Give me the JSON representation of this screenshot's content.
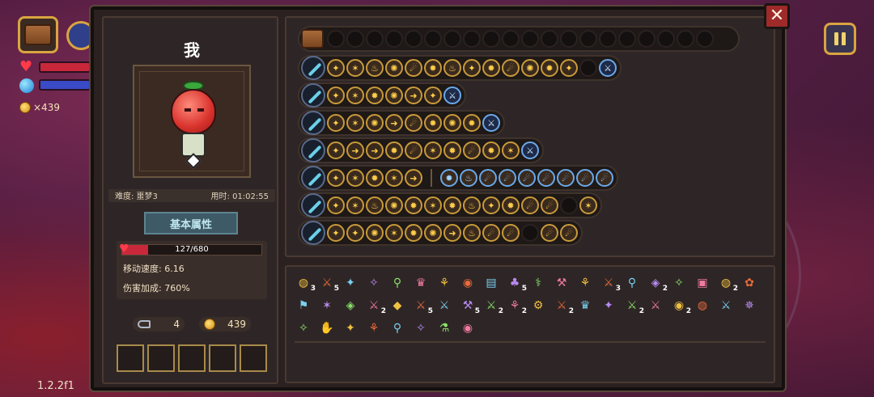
{
  "hud": {
    "gold": "×439",
    "version": "1.2.2f1",
    "close": "✕"
  },
  "character": {
    "name": "我",
    "difficulty": "难度: 噩梦3",
    "time": "用时: 01:02:55",
    "tab": "基本属性",
    "hp": {
      "text": "127/680",
      "fraction": 0.187
    },
    "speed": "移动速度: 6.16",
    "damage": "伤害加成: 760%",
    "keys": "4",
    "coins": "439"
  },
  "icons": {
    "chest": "chest-icon",
    "pause": "pause-icon",
    "close": "close-icon",
    "heart": "heart-icon",
    "mana": "mana-orb-icon",
    "coin": "coin-icon",
    "key": "key-icon"
  },
  "colors": {
    "hp": "#c8283a",
    "mp": "#3a4bc8",
    "gold_border": "#d9a441",
    "close": "#9e2a2a",
    "tab": "#3e5a66"
  },
  "chest_row_empty_slots": 20,
  "weapons": [
    {
      "weapon": "emerald-staff",
      "chips": [
        "✦",
        "✶",
        "♨",
        "✺",
        "☄",
        "✹",
        "♨",
        "✦",
        "✹",
        "☄",
        "✺",
        "✹",
        "✦",
        ""
      ],
      "blue": 1
    },
    {
      "weapon": "azure-spear",
      "chips": [
        "✦",
        "✶",
        "✹",
        "✺",
        "➜",
        "✦"
      ],
      "blue": 1
    },
    {
      "weapon": "violet-flower-staff",
      "chips": [
        "✦",
        "✶",
        "✺",
        "➜",
        "☄",
        "✹",
        "✺",
        "✹"
      ],
      "blue": 1
    },
    {
      "weapon": "shadow-scythe",
      "chips": [
        "✦",
        "➜",
        "➜",
        "✹",
        "☄",
        "✶",
        "✹",
        "☄",
        "✹",
        "✶"
      ],
      "blue": 1
    },
    {
      "weapon": "void-halberd",
      "chips": [
        "✦",
        "✶",
        "✹",
        "✶",
        "➜"
      ],
      "blue": 0,
      "chips2": [
        "✹",
        "♨",
        "☄",
        "☄",
        "☄",
        "☄",
        "☄",
        "☄",
        "☄"
      ]
    },
    {
      "weapon": "arcane-staff",
      "chips": [
        "✦",
        "✶",
        "♨",
        "✺",
        "✹",
        "✶",
        "✹",
        "♨",
        "✦",
        "✹",
        "☄",
        "☄",
        "",
        "✶"
      ],
      "blue": 0
    },
    {
      "weapon": "eclipse-orb-staff",
      "chips": [
        "✦",
        "✦",
        "✺",
        "✶",
        "✹",
        "✺",
        "➜",
        "♨",
        "☄",
        "☄",
        "",
        "☄",
        "☄"
      ],
      "blue": 0
    }
  ],
  "items": [
    {
      "g": "◍",
      "c": "3"
    },
    {
      "g": "⚔",
      "c": "5"
    },
    {
      "g": "✦",
      "c": ""
    },
    {
      "g": "✧",
      "c": ""
    },
    {
      "g": "⚲",
      "c": ""
    },
    {
      "g": "♛",
      "c": ""
    },
    {
      "g": "⚘",
      "c": ""
    },
    {
      "g": "◉",
      "c": ""
    },
    {
      "g": "▤",
      "c": ""
    },
    {
      "g": "♣",
      "c": "5"
    },
    {
      "g": "⚕",
      "c": ""
    },
    {
      "g": "⚒",
      "c": ""
    },
    {
      "g": "⚘",
      "c": ""
    },
    {
      "g": "⚔",
      "c": "3"
    },
    {
      "g": "⚲",
      "c": ""
    },
    {
      "g": "◈",
      "c": "2"
    },
    {
      "g": "✧",
      "c": ""
    },
    {
      "g": "▣",
      "c": ""
    },
    {
      "g": "◍",
      "c": "2"
    },
    {
      "g": "✿",
      "c": ""
    },
    {
      "g": "⚑",
      "c": ""
    },
    {
      "g": "✶",
      "c": ""
    },
    {
      "g": "◈",
      "c": ""
    },
    {
      "g": "⚔",
      "c": "2"
    },
    {
      "g": "◆",
      "c": ""
    },
    {
      "g": "⚔",
      "c": "5"
    },
    {
      "g": "⚔",
      "c": ""
    },
    {
      "g": "⚒",
      "c": "5"
    },
    {
      "g": "⚔",
      "c": "2"
    },
    {
      "g": "⚘",
      "c": "2"
    },
    {
      "g": "⚙",
      "c": ""
    },
    {
      "g": "⚔",
      "c": "2"
    },
    {
      "g": "♛",
      "c": ""
    },
    {
      "g": "✦",
      "c": ""
    },
    {
      "g": "⚔",
      "c": "2"
    },
    {
      "g": "⚔",
      "c": ""
    },
    {
      "g": "◉",
      "c": "2"
    },
    {
      "g": "◍",
      "c": ""
    },
    {
      "g": "⚔",
      "c": ""
    },
    {
      "g": "✵",
      "c": ""
    },
    {
      "g": "✧",
      "c": ""
    },
    {
      "g": "✋",
      "c": ""
    },
    {
      "g": "✦",
      "c": ""
    },
    {
      "g": "⚘",
      "c": ""
    },
    {
      "g": "⚲",
      "c": ""
    },
    {
      "g": "✧",
      "c": ""
    },
    {
      "g": "⚗",
      "c": ""
    },
    {
      "g": "◉",
      "c": ""
    }
  ]
}
